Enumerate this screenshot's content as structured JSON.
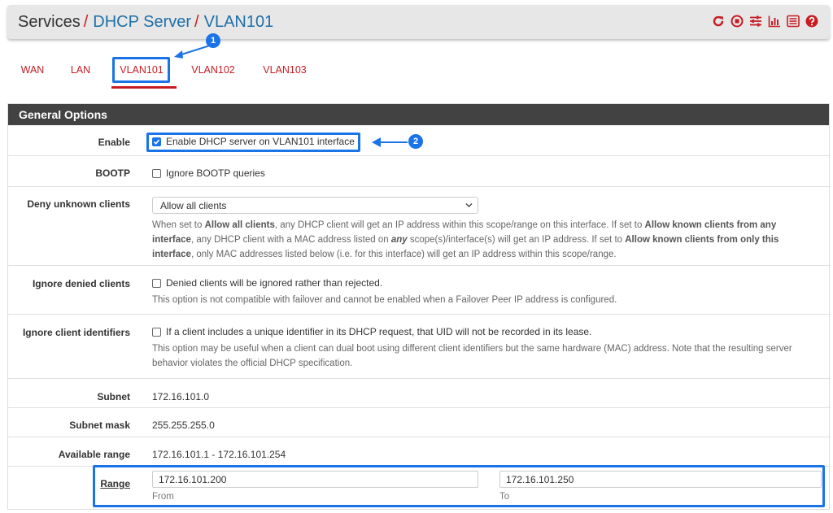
{
  "header": {
    "breadcrumb": [
      "Services",
      "DHCP Server",
      "VLAN101"
    ],
    "separator": "/",
    "icons": [
      "restart-icon",
      "stop-icon",
      "settings-sliders-icon",
      "chart-icon",
      "log-list-icon",
      "help-icon"
    ]
  },
  "tabs": [
    {
      "label": "WAN",
      "active": false
    },
    {
      "label": "LAN",
      "active": false
    },
    {
      "label": "VLAN101",
      "active": true
    },
    {
      "label": "VLAN102",
      "active": false
    },
    {
      "label": "VLAN103",
      "active": false
    }
  ],
  "annotations": {
    "badge1": "1",
    "badge2": "2"
  },
  "panel": {
    "title": "General Options",
    "enable": {
      "label": "Enable",
      "checkbox_text": "Enable DHCP server on VLAN101 interface",
      "checked": true
    },
    "bootp": {
      "label": "BOOTP",
      "checkbox_text": "Ignore BOOTP queries",
      "checked": false
    },
    "deny_unknown": {
      "label": "Deny unknown clients",
      "selected": "Allow all clients",
      "help": {
        "t1": "When set to ",
        "b1": "Allow all clients",
        "t2": ", any DHCP client will get an IP address within this scope/range on this interface. If set to ",
        "b2": "Allow known clients from any interface",
        "t3": ", any DHCP client with a MAC address listed on ",
        "b3": "any",
        "t4": " scope(s)/interface(s) will get an IP address. If set to ",
        "b4": "Allow known clients from only this interface",
        "t5": ", only MAC addresses listed below (i.e. for this interface) will get an IP address within this scope/range."
      }
    },
    "ignore_denied": {
      "label": "Ignore denied clients",
      "checkbox_text": "Denied clients will be ignored rather than rejected.",
      "checked": false,
      "help": "This option is not compatible with failover and cannot be enabled when a Failover Peer IP address is configured."
    },
    "ignore_client_ids": {
      "label": "Ignore client identifiers",
      "checkbox_text": "If a client includes a unique identifier in its DHCP request, that UID will not be recorded in its lease.",
      "checked": false,
      "help": "This option may be useful when a client can dual boot using different client identifiers but the same hardware (MAC) address. Note that the resulting server behavior violates the official DHCP specification."
    },
    "subnet": {
      "label": "Subnet",
      "value": "172.16.101.0"
    },
    "subnet_mask": {
      "label": "Subnet mask",
      "value": "255.255.255.0"
    },
    "available_range": {
      "label": "Available range",
      "value": "172.16.101.1 - 172.16.101.254"
    },
    "range": {
      "label": "Range",
      "from_value": "172.16.101.200",
      "from_label": "From",
      "to_value": "172.16.101.250",
      "to_label": "To"
    }
  },
  "colors": {
    "accent_red": "#c71c22",
    "link_blue": "#1e6fa8",
    "annotation_blue": "#1a73e8",
    "panel_heading": "#424242"
  }
}
